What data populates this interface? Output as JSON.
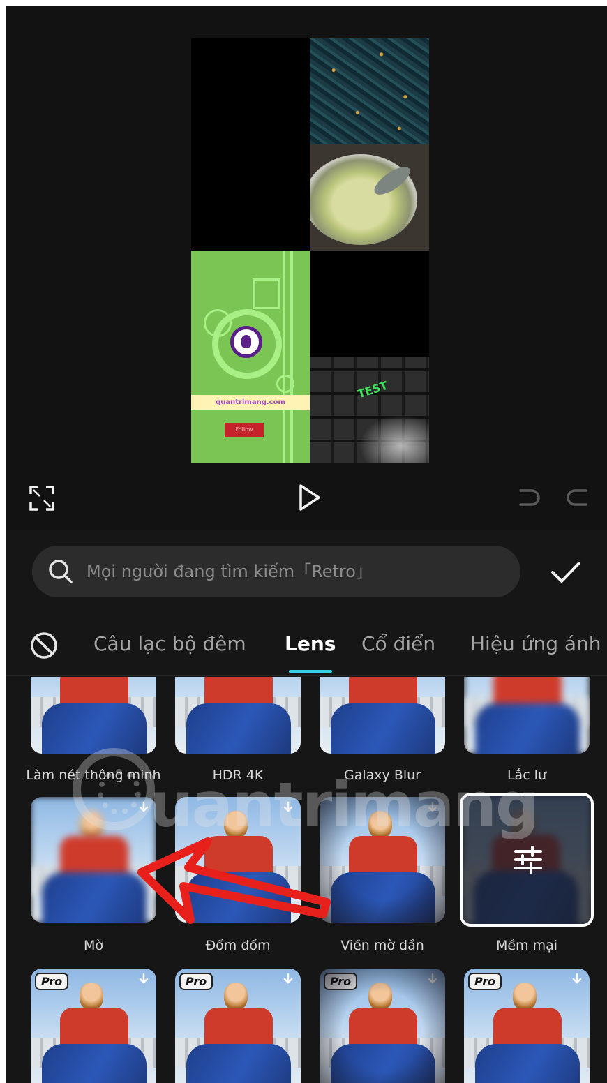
{
  "preview": {
    "keyboard_sticker": "TEST",
    "green_banner": "quantrimang.com",
    "green_button": "Follow"
  },
  "controls": {
    "fullscreen": "fullscreen-icon",
    "play": "play-icon",
    "undo": "undo-icon",
    "redo": "redo-icon"
  },
  "search": {
    "placeholder": "Mọi người đang tìm kiếm「Retro」"
  },
  "tabs": [
    {
      "label": "Câu lạc bộ đêm",
      "active": false
    },
    {
      "label": "Lens",
      "active": true
    },
    {
      "label": "Cổ điển",
      "active": false
    },
    {
      "label": "Hiệu ứng ánh",
      "active": false
    }
  ],
  "effects": {
    "row1": [
      "Làm nét thông minh",
      "HDR 4K",
      "Galaxy Blur",
      "Lắc lư"
    ],
    "row2": [
      "Mờ",
      "Đốm đốm",
      "Viền mờ dần",
      "Mềm mại"
    ],
    "pro_badge": "Pro"
  },
  "watermark": "uantrimang",
  "colors": {
    "accent": "#35d0e4",
    "annotation_arrow": "#e8201b",
    "panel_bg": "#161616"
  }
}
